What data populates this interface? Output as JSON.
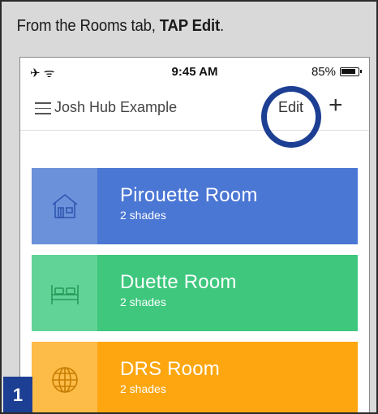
{
  "instruction": {
    "prefix": "From the Rooms tab, ",
    "bold": "TAP Edit",
    "suffix": "."
  },
  "status_bar": {
    "left": "✈ ᯤ",
    "time": "9:45 AM",
    "battery": "85%"
  },
  "nav": {
    "hub_name": "Josh Hub Example",
    "edit_label": "Edit",
    "add_label": "+"
  },
  "rooms": [
    {
      "name": "Pirouette Room",
      "count": "2 shades",
      "color": "#4a76d4",
      "icon_bg": "#6b91da",
      "icon": "house-icon"
    },
    {
      "name": "Duette Room",
      "count": "2 shades",
      "color": "#3ec77d",
      "icon_bg": "#62d396",
      "icon": "bed-icon"
    },
    {
      "name": "DRS Room",
      "count": "2 shades",
      "color": "#fda60f",
      "icon_bg": "#fdbb48",
      "icon": "globe-icon"
    }
  ],
  "step_number": "1",
  "colors": {
    "highlight": "#1d3f93",
    "frame_bg": "#d9d9d9"
  }
}
